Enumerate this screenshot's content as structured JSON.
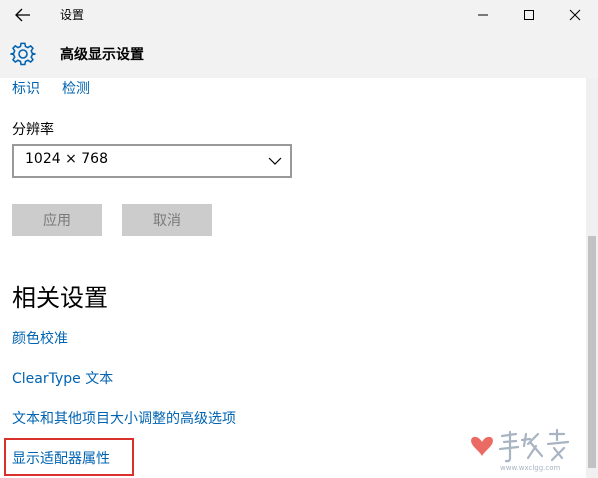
{
  "window": {
    "title": "设置"
  },
  "header": {
    "page_title": "高级显示设置"
  },
  "top_links": {
    "identify": "标识",
    "detect": "检测"
  },
  "resolution": {
    "label": "分辨率",
    "value": "1024 × 768"
  },
  "buttons": {
    "apply": "应用",
    "cancel": "取消"
  },
  "related": {
    "title": "相关设置",
    "items": [
      "颜色校准",
      "ClearType 文本",
      "文本和其他项目大小调整的高级选项",
      "显示适配器属性"
    ]
  },
  "colors": {
    "link": "#0063b1",
    "highlight": "#d9302c",
    "chrome": "#f2f2f2"
  },
  "icons": {
    "back": "back-arrow-icon",
    "settings": "gear-icon",
    "minimize": "minimize-icon",
    "maximize": "maximize-icon",
    "close": "close-icon",
    "dropdown": "chevron-down-icon"
  }
}
